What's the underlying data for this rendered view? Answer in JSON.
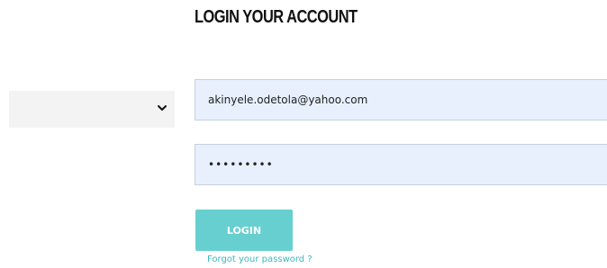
{
  "login": {
    "title": "LOGIN YOUR ACCOUNT",
    "select": {
      "value": "",
      "icon": "chevron-down-icon"
    },
    "email": {
      "value": "akinyele.odetola@yahoo.com",
      "placeholder": ""
    },
    "password": {
      "value": "•••••••••",
      "placeholder": ""
    },
    "button_label": "LOGIN",
    "forgot_label": "Forgot your password ?"
  },
  "colors": {
    "field_background": "#e8f0fe",
    "button_background": "#67cfd0",
    "link": "#3fb7bf",
    "select_background": "#f3f3f3"
  }
}
